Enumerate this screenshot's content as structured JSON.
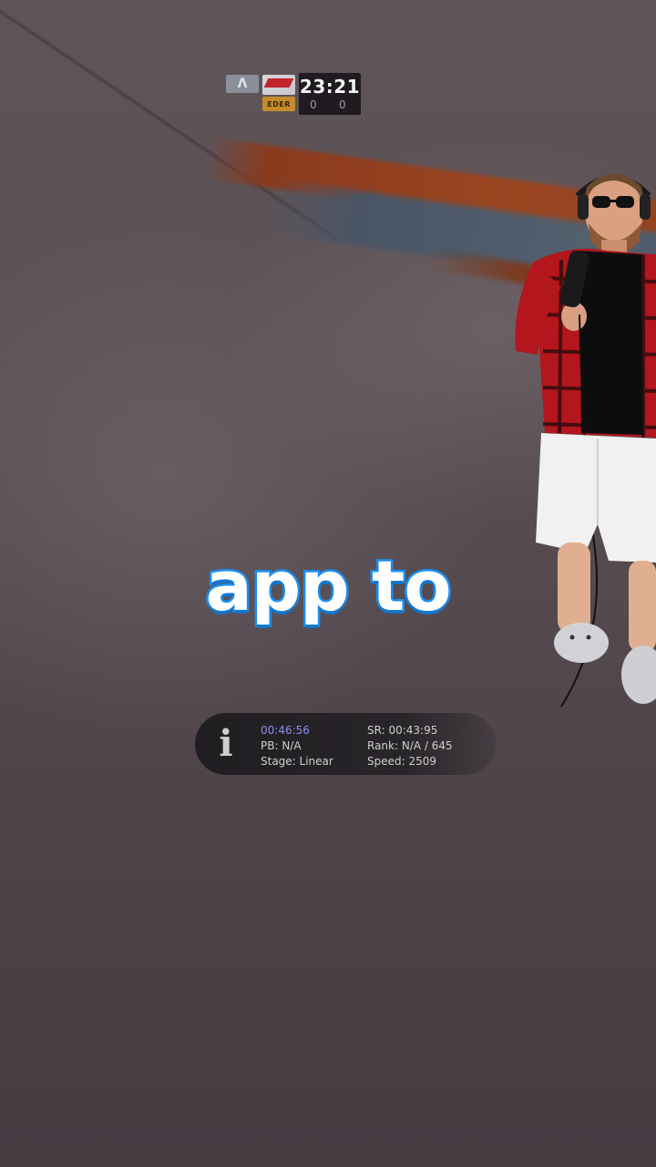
{
  "hud": {
    "team_icon": "shield-emblem-icon",
    "flag_icon": "red-white-flag-icon",
    "badge_text": "EDER",
    "timer": "23:21",
    "score_left": "0",
    "score_right": "0"
  },
  "caption": {
    "text": "app to",
    "color": "#ffffff",
    "outline_color": "#1d8ff0"
  },
  "info_panel": {
    "icon": "info-icon",
    "icon_glyph": "i",
    "time": "00:46:56",
    "pb": "PB: N/A",
    "stage": "Stage: Linear",
    "sr": "SR: 00:43:95",
    "rank": "Rank: N/A / 645",
    "speed": "Speed: 2509"
  },
  "colors": {
    "accent": "#1d8ff0",
    "timer_color": "#8c8ff0",
    "background": "#4d4449"
  }
}
